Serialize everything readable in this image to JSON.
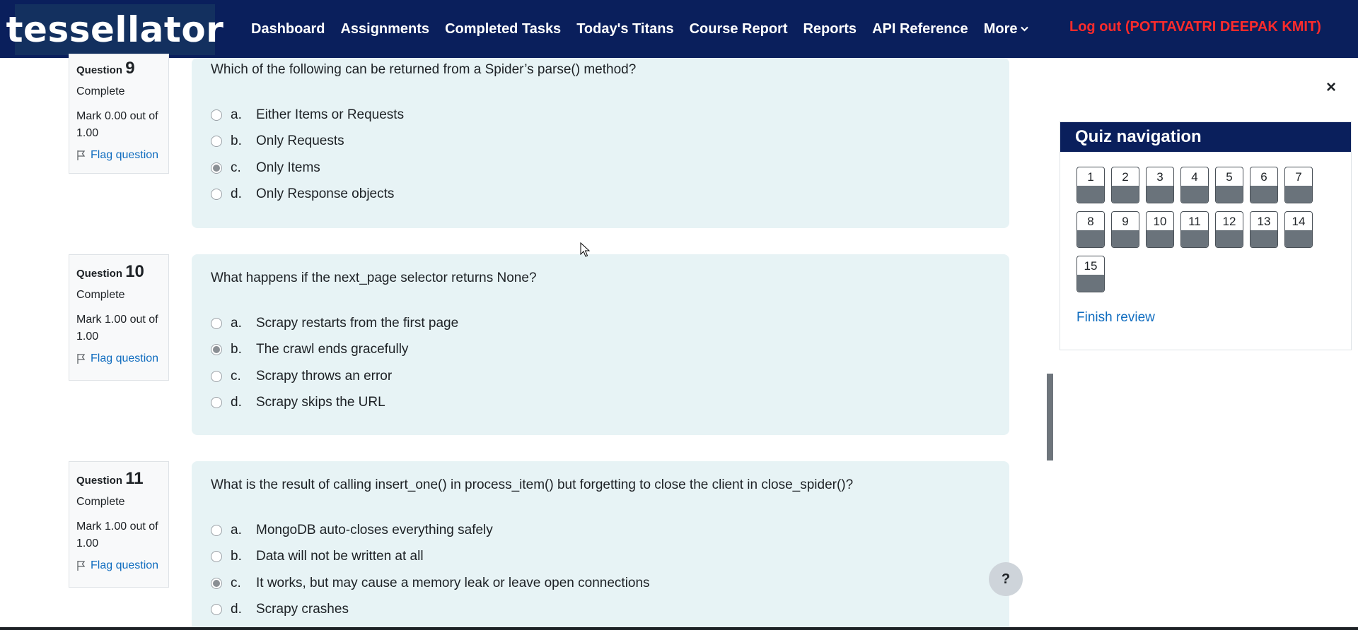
{
  "header": {
    "logo": "tessellator",
    "nav": [
      "Dashboard",
      "Assignments",
      "Completed Tasks",
      "Today's Titans",
      "Course Report",
      "Reports",
      "API Reference"
    ],
    "more": "More",
    "logout": "Log out (POTTAVATRI DEEPAK KMIT)"
  },
  "questions": [
    {
      "label": "Question",
      "number": "9",
      "state": "Complete",
      "mark": "Mark 0.00 out of 1.00",
      "flag": "Flag question",
      "text": "Which of the following can be returned from a Spider’s parse() method?",
      "answers": [
        {
          "letter": "a.",
          "text": "Either Items or Requests",
          "checked": false
        },
        {
          "letter": "b.",
          "text": "Only Requests",
          "checked": false
        },
        {
          "letter": "c.",
          "text": "Only Items",
          "checked": true
        },
        {
          "letter": "d.",
          "text": "Only Response objects",
          "checked": false
        }
      ]
    },
    {
      "label": "Question",
      "number": "10",
      "state": "Complete",
      "mark": "Mark 1.00 out of 1.00",
      "flag": "Flag question",
      "text": "What happens if the next_page selector returns None?",
      "answers": [
        {
          "letter": "a.",
          "text": "Scrapy restarts from the first page",
          "checked": false
        },
        {
          "letter": "b.",
          "text": "The crawl ends gracefully",
          "checked": true
        },
        {
          "letter": "c.",
          "text": "Scrapy throws an error",
          "checked": false
        },
        {
          "letter": "d.",
          "text": "Scrapy skips the URL",
          "checked": false
        }
      ]
    },
    {
      "label": "Question",
      "number": "11",
      "state": "Complete",
      "mark": "Mark 1.00 out of 1.00",
      "flag": "Flag question",
      "text": "What is the result of calling insert_one() in process_item() but forgetting to close the client in close_spider()?",
      "answers": [
        {
          "letter": "a.",
          "text": "MongoDB auto-closes everything safely",
          "checked": false
        },
        {
          "letter": "b.",
          "text": "Data will not be written at all",
          "checked": false
        },
        {
          "letter": "c.",
          "text": "It works, but may cause a memory leak or leave open connections",
          "checked": true
        },
        {
          "letter": "d.",
          "text": "Scrapy crashes",
          "checked": false
        }
      ]
    }
  ],
  "quiz_nav": {
    "title": "Quiz navigation",
    "buttons": [
      "1",
      "2",
      "3",
      "4",
      "5",
      "6",
      "7",
      "8",
      "9",
      "10",
      "11",
      "12",
      "13",
      "14",
      "15"
    ],
    "finish": "Finish review"
  },
  "close_icon": "×",
  "help": "?"
}
